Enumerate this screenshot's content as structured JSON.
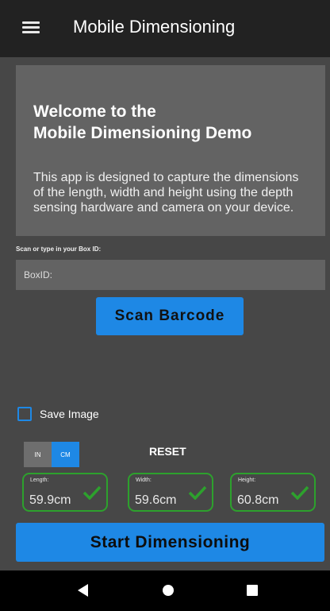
{
  "appbar": {
    "menu_icon": "hamburger-menu-icon",
    "title": "Mobile Dimensioning"
  },
  "welcome": {
    "title_line1": "Welcome to the",
    "title_line2": "Mobile Dimensioning Demo",
    "description": "This app is designed to capture the dimensions of the length, width and height using the depth sensing hardware and camera on your device."
  },
  "box_id": {
    "label": "Scan or type in your Box ID:",
    "placeholder": "BoxID:",
    "value": ""
  },
  "scan_button": {
    "label": "Scan Barcode"
  },
  "save_image": {
    "label": "Save Image",
    "checked": false
  },
  "units": {
    "in_label": "IN",
    "cm_label": "CM",
    "selected": "CM"
  },
  "reset_label": "RESET",
  "dimensions": [
    {
      "label": "Length:",
      "value": "59.9cm",
      "status_icon": "check-icon"
    },
    {
      "label": "Width:",
      "value": "59.6cm",
      "status_icon": "check-icon"
    },
    {
      "label": "Height:",
      "value": "60.8cm",
      "status_icon": "check-icon"
    }
  ],
  "start_button": {
    "label": "Start Dimensioning"
  },
  "navbar": {
    "back_icon": "back-triangle-icon",
    "home_icon": "home-circle-icon",
    "recent_icon": "recent-apps-square-icon"
  },
  "colors": {
    "accent": "#1e88e5",
    "success": "#2da12d",
    "appbar": "#222222",
    "background": "#474747",
    "panel": "#636363"
  }
}
